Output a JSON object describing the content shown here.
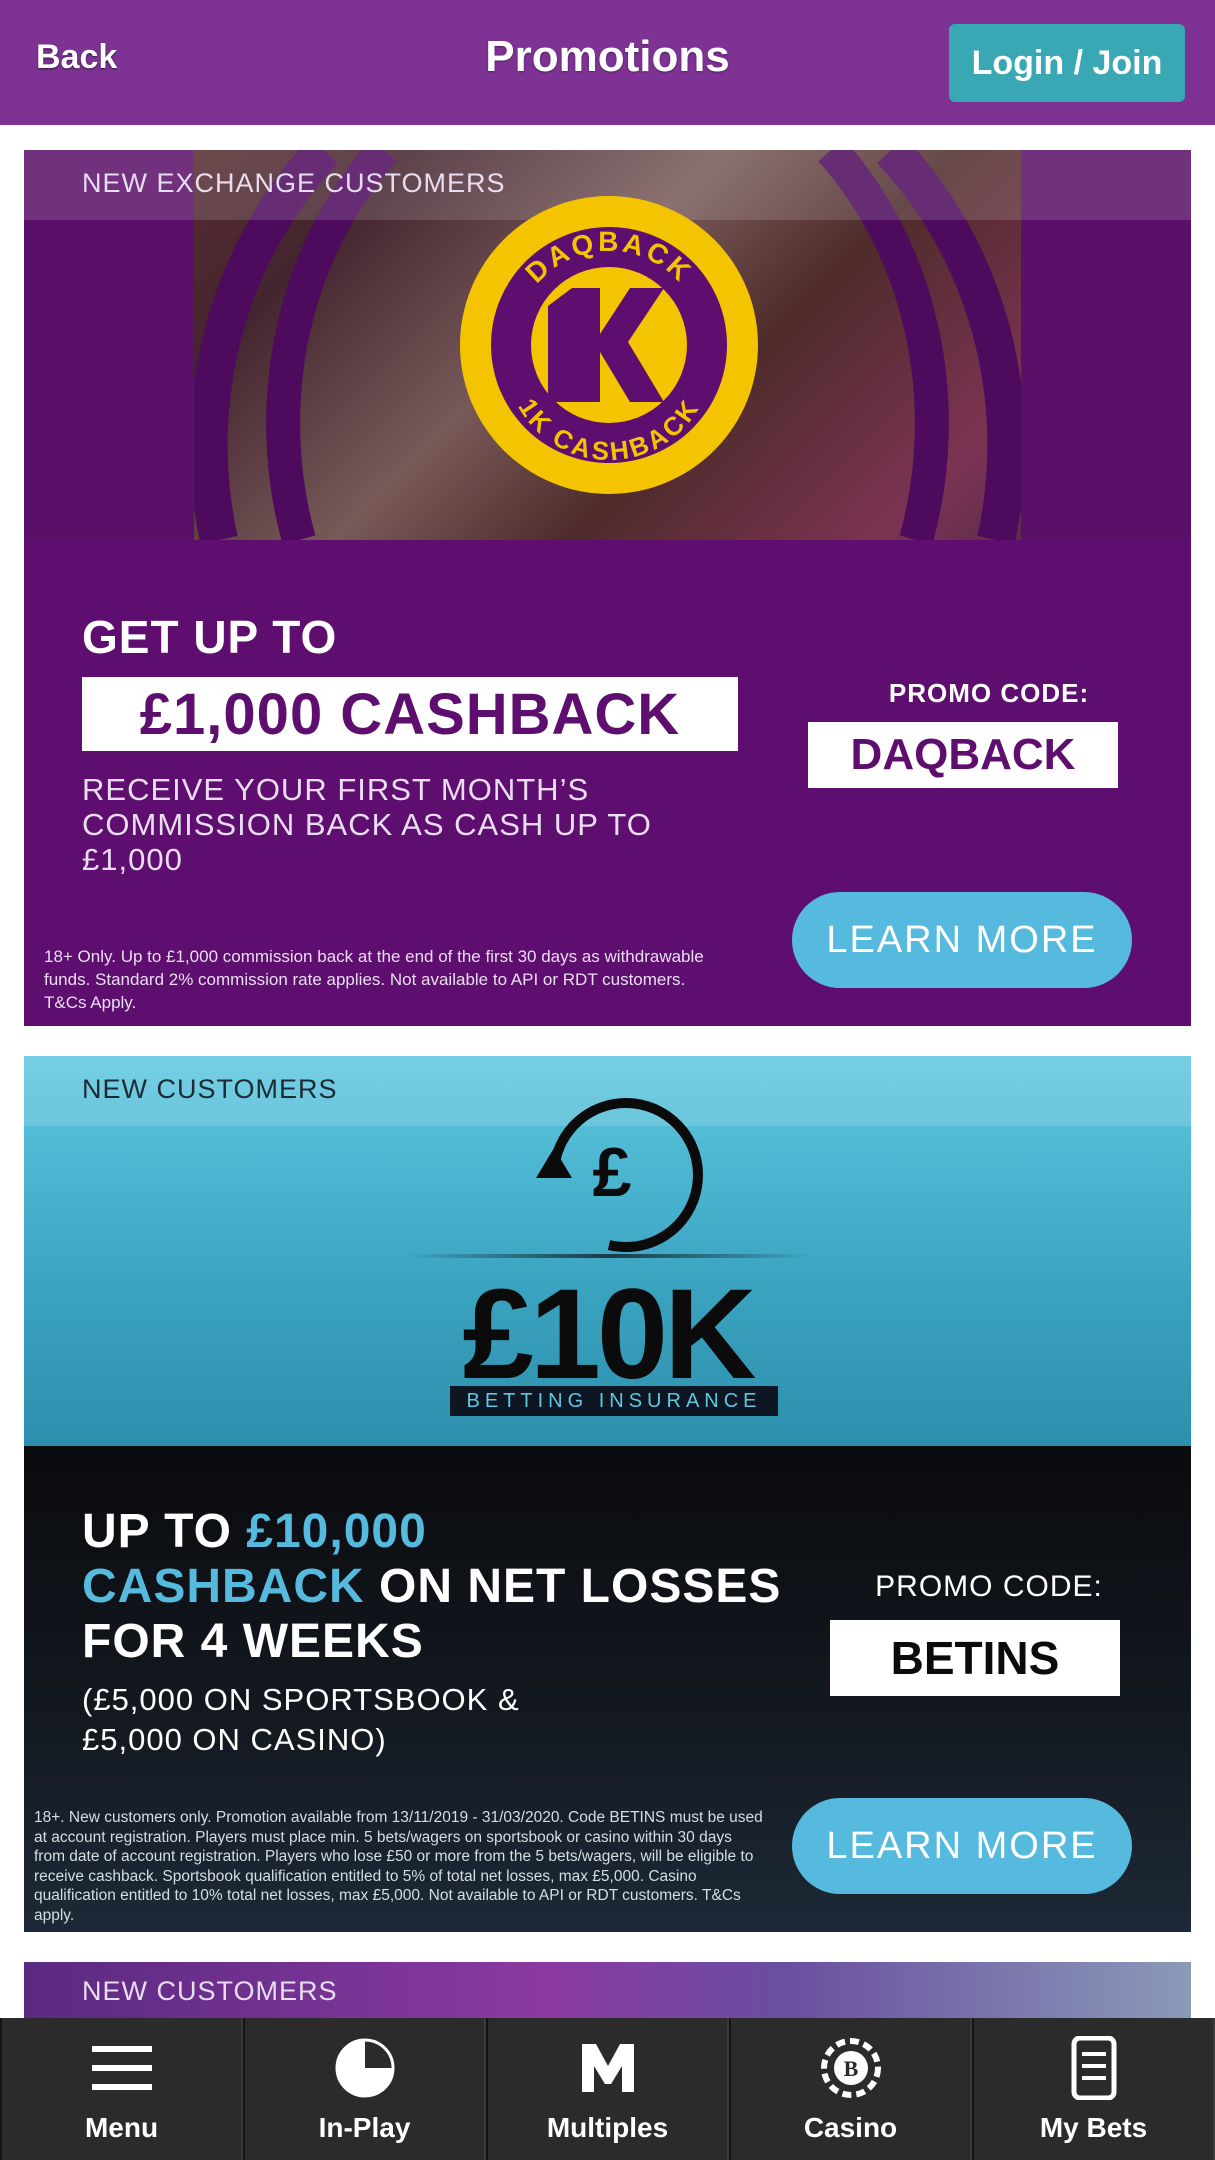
{
  "header": {
    "back_label": "Back",
    "title": "Promotions",
    "login_label": "Login / Join"
  },
  "promos": [
    {
      "tag": "NEW EXCHANGE CUSTOMERS",
      "logo_text_top": "DAQBACK",
      "logo_text_bottom": "1K CASHBACK",
      "logo_mark": "1K",
      "headline": "GET UP TO",
      "amount": "£1,000 CASHBACK",
      "body": "RECEIVE YOUR FIRST MONTH’S COMMISSION BACK AS CASH UP TO £1,000",
      "promo_label": "PROMO CODE:",
      "promo_code": "DAQBACK",
      "cta": "LEARN MORE",
      "fine_print": "18+ Only. Up to £1,000 commission back at the end of the first 30 days as withdrawable funds. Standard 2% commission rate applies. Not available to API or RDT customers. T&Cs Apply."
    },
    {
      "tag": "NEW CUSTOMERS",
      "big_value": "£10K",
      "big_value_sub": "BETTING INSURANCE",
      "headline_1": "UP TO ",
      "headline_hl_1": "£10,000",
      "headline_hl_2": "CASHBACK",
      "headline_2": " ON NET LOSSES FOR 4 WEEKS",
      "sub": "(£5,000 ON SPORTSBOOK & £5,000 ON CASINO)",
      "promo_label": "PROMO CODE:",
      "promo_code": "BETINS",
      "cta": "LEARN MORE",
      "fine_print": "18+. New customers only. Promotion available from 13/11/2019 - 31/03/2020. Code BETINS must be used at account registration. Players must place min. 5 bets/wagers on sportsbook or casino within 30 days from date of account registration. Players who lose £50 or more from the 5 bets/wagers, will be eligible to receive cashback. Sportsbook qualification entitled to 5% of total net losses, max £5,000. Casino qualification entitled to 10% total net losses, max £5,000. Not available to API or RDT customers. T&Cs apply."
    },
    {
      "tag": "NEW CUSTOMERS"
    }
  ],
  "bottom_nav": [
    {
      "label": "Menu",
      "icon": "hamburger-icon"
    },
    {
      "label": "In-Play",
      "icon": "in-play-pie-icon"
    },
    {
      "label": "Multiples",
      "icon": "multiples-m-icon"
    },
    {
      "label": "Casino",
      "icon": "casino-chip-icon"
    },
    {
      "label": "My Bets",
      "icon": "betslip-icon"
    }
  ],
  "colors": {
    "header_bg": "#7e3394",
    "login_bg": "#3aa7b4",
    "promo1_bg": "#5e0e6e",
    "logo_yellow": "#f5c400",
    "cta_blue": "#56b9de",
    "nav_bg": "#2b2b2b"
  }
}
